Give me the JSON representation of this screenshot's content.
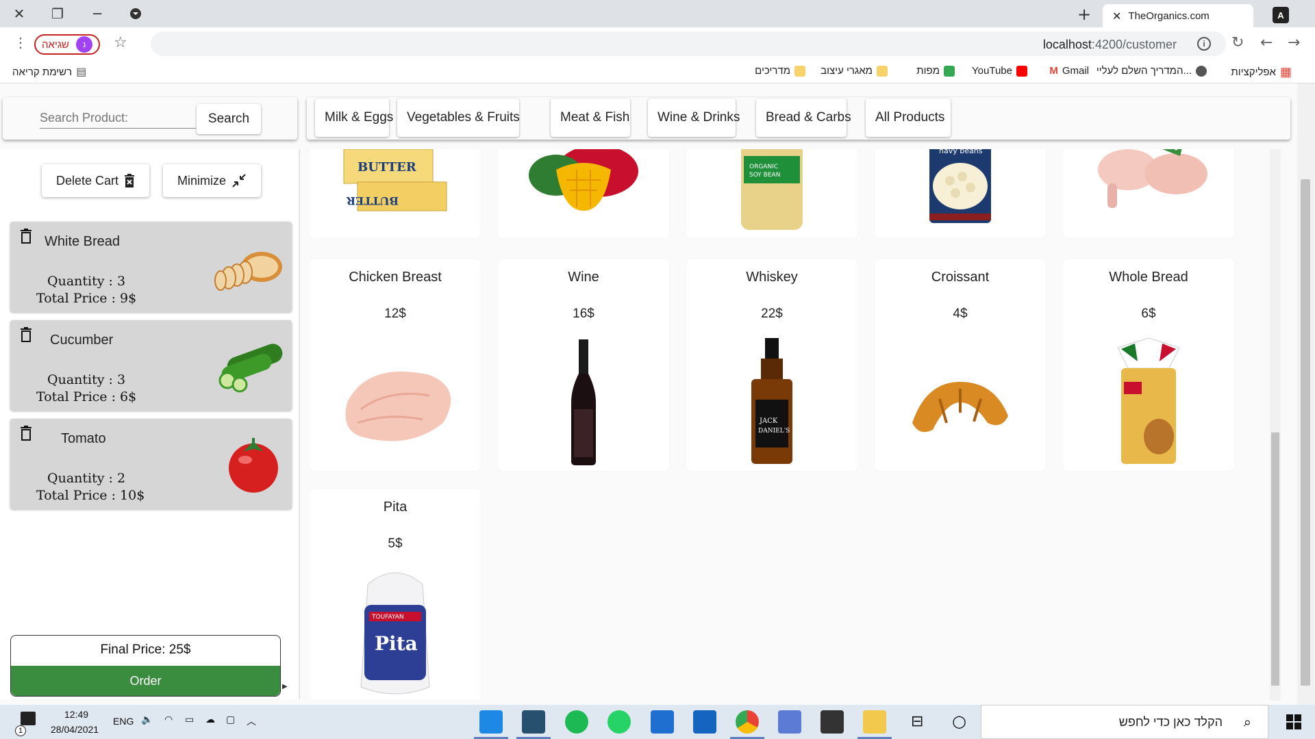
{
  "browser": {
    "tab_title": "TheOrganics.com",
    "url_host": "localhost",
    "url_path": ":4200/customer",
    "profile_label": "שגיאה",
    "profile_initial": "נ",
    "bookmarks": [
      {
        "label": "אפליקציות",
        "color": "#ea4335"
      },
      {
        "label": "המדריך השלם לעליי...",
        "color": "#555555"
      },
      {
        "label": "Gmail",
        "color": "#ea4335"
      },
      {
        "label": "YouTube",
        "color": "#ff0000"
      },
      {
        "label": "מפות",
        "color": "#34a853"
      },
      {
        "label": "מאגרי עיצוב",
        "color": "#f6d36b"
      },
      {
        "label": "מדריכים",
        "color": "#f6d36b"
      }
    ],
    "reading_list": "רשימת קריאה"
  },
  "header": {
    "search_placeholder": "Search Product:",
    "search_button": "Search",
    "categories": [
      "Milk & Eggs",
      "Vegetables & Fruits",
      "Meat & Fish",
      "Wine & Drinks",
      "Bread & Carbs",
      "All Products"
    ]
  },
  "cart": {
    "delete_label": "Delete Cart",
    "minimize_label": "Minimize",
    "items": [
      {
        "name": "White Bread",
        "quantity": "Quantity : 3",
        "total": "Total Price : 9$",
        "icon": "bread-icon"
      },
      {
        "name": "Cucumber",
        "quantity": "Quantity : 3",
        "total": "Total Price : 6$",
        "icon": "cucumber-icon"
      },
      {
        "name": "Tomato",
        "quantity": "Quantity : 2",
        "total": "Total Price : 10$",
        "icon": "tomato-icon"
      }
    ],
    "final_price": "Final Price: 25$",
    "order_label": "Order"
  },
  "products": {
    "row_top": [
      {
        "icon": "butter-icon"
      },
      {
        "icon": "mango-icon"
      },
      {
        "icon": "soybean-icon"
      },
      {
        "icon": "navy-beans-icon"
      },
      {
        "icon": "chicken-legs-icon"
      }
    ],
    "row_mid": [
      {
        "name": "Chicken Breast",
        "price": "12$",
        "icon": "chicken-breast-icon"
      },
      {
        "name": "Wine",
        "price": "16$",
        "icon": "wine-icon"
      },
      {
        "name": "Whiskey",
        "price": "22$",
        "icon": "whiskey-icon"
      },
      {
        "name": "Croissant",
        "price": "4$",
        "icon": "croissant-icon"
      },
      {
        "name": "Whole Bread",
        "price": "6$",
        "icon": "whole-bread-icon"
      }
    ],
    "row_bottom": [
      {
        "name": "Pita",
        "price": "5$",
        "icon": "pita-icon"
      }
    ]
  },
  "taskbar": {
    "time": "12:49",
    "date": "28/04/2021",
    "lang": "ENG",
    "search_placeholder": "הקלד כאן כדי לחפש",
    "notification_count": "1"
  }
}
